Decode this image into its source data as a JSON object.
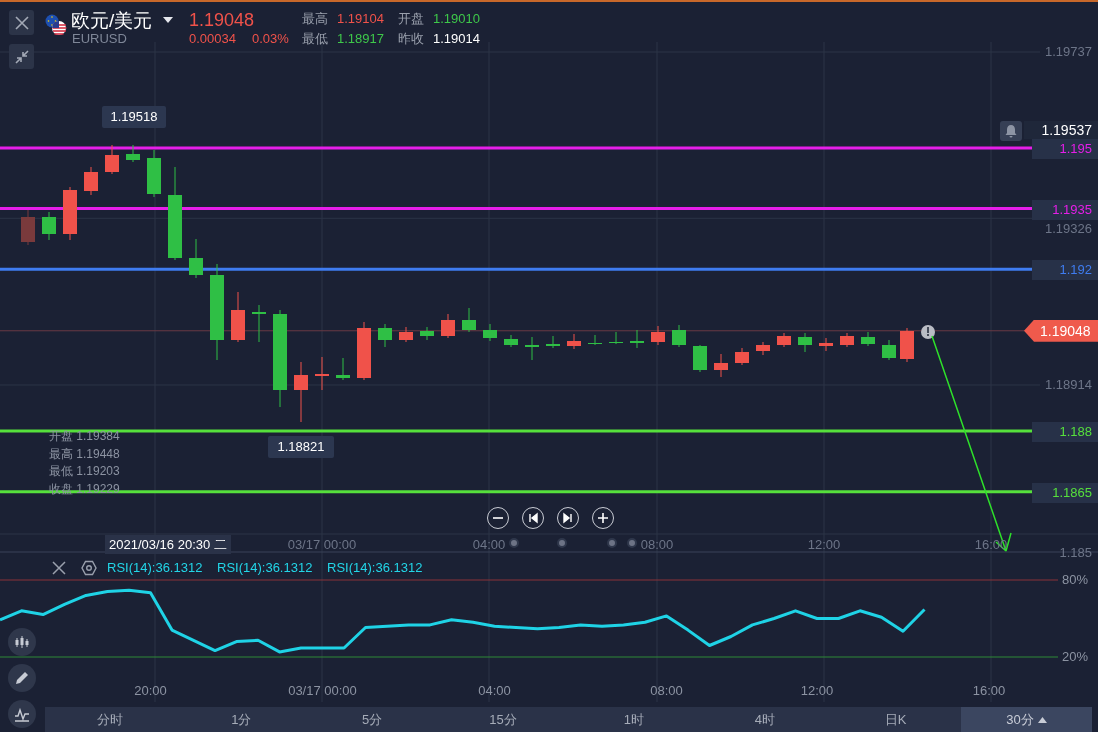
{
  "header": {
    "symbol_name": "欧元/美元",
    "symbol_code": "EURUSD",
    "price": "1.19048",
    "change": "0.00034",
    "change_percent": "0.03%",
    "stats": [
      {
        "label": "最高",
        "value": "1.19104",
        "color": "#f0524a"
      },
      {
        "label": "开盘",
        "value": "1.19010",
        "color": "#3ec84a"
      },
      {
        "label": "最低",
        "value": "1.18917",
        "color": "#3ec84a"
      },
      {
        "label": "昨收",
        "value": "1.19014",
        "color": "#ffffff"
      }
    ]
  },
  "price_axis": {
    "ticks": [
      "1.19737",
      "1.19326",
      "1.18914",
      "1.185"
    ]
  },
  "levels": [
    {
      "value": "1.195",
      "color": "#e51ee8"
    },
    {
      "value": "1.1935",
      "color": "#e51ee8"
    },
    {
      "value": "1.192",
      "color": "#3f7cf0"
    },
    {
      "value": "1.188",
      "color": "#56e03c"
    },
    {
      "value": "1.1865",
      "color": "#56e03c"
    }
  ],
  "alert": {
    "price": "1.19537"
  },
  "current_price": "1.19048",
  "annotations": [
    {
      "kind": "high",
      "value": "1.19518"
    },
    {
      "kind": "low",
      "value": "1.18821"
    }
  ],
  "ohlc_overlay": [
    "开盘 1.19384",
    "最高 1.19448",
    "最低 1.19203",
    "收盘 1.19229"
  ],
  "time_axis": {
    "cursor_label": "2021/03/16 20:30 二",
    "labels": [
      "03/17 00:00",
      "04:00",
      "08:00",
      "12:00",
      "16:00"
    ]
  },
  "rsi": {
    "legends": [
      "RSI(14):36.1312",
      "RSI(14):36.1312",
      "RSI(14):36.1312"
    ],
    "chart_data": {
      "type": "line",
      "categories": [
        null,
        null,
        null,
        null,
        null,
        null,
        null,
        "20:00",
        null,
        null,
        null,
        null,
        null,
        null,
        null,
        "03/17 00:00",
        null,
        null,
        null,
        null,
        null,
        null,
        null,
        "04:00",
        null,
        null,
        null,
        null,
        null,
        null,
        null,
        "08:00",
        null,
        null,
        null,
        null,
        null,
        null,
        "12:00",
        null,
        null,
        null,
        null,
        null,
        null,
        null,
        "16:00",
        null,
        null,
        null,
        null
      ],
      "series": [
        {
          "color": "#1fd3e6",
          "values": [
            49,
            56,
            53,
            61,
            68,
            71,
            72,
            70,
            41,
            33,
            25,
            32,
            33,
            24,
            27,
            27,
            27,
            43,
            44,
            45,
            45,
            49,
            47,
            44,
            43,
            42,
            43,
            45,
            44,
            45,
            47,
            52,
            41,
            29,
            36,
            45,
            50,
            56,
            50,
            50,
            56,
            51,
            40,
            57,
            null,
            null,
            null,
            null,
            null,
            null,
            null
          ]
        }
      ],
      "ylim": [
        20,
        80
      ],
      "yticks": [
        {
          "value": 20,
          "label": "20%"
        },
        {
          "value": 80,
          "label": "80%"
        }
      ]
    }
  },
  "timeframes": [
    {
      "label": "分时",
      "selected": false
    },
    {
      "label": "1分",
      "selected": false
    },
    {
      "label": "5分",
      "selected": false
    },
    {
      "label": "15分",
      "selected": false
    },
    {
      "label": "1时",
      "selected": false
    },
    {
      "label": "4时",
      "selected": false
    },
    {
      "label": "日K",
      "selected": false
    },
    {
      "label": "30分",
      "selected": true
    }
  ]
}
